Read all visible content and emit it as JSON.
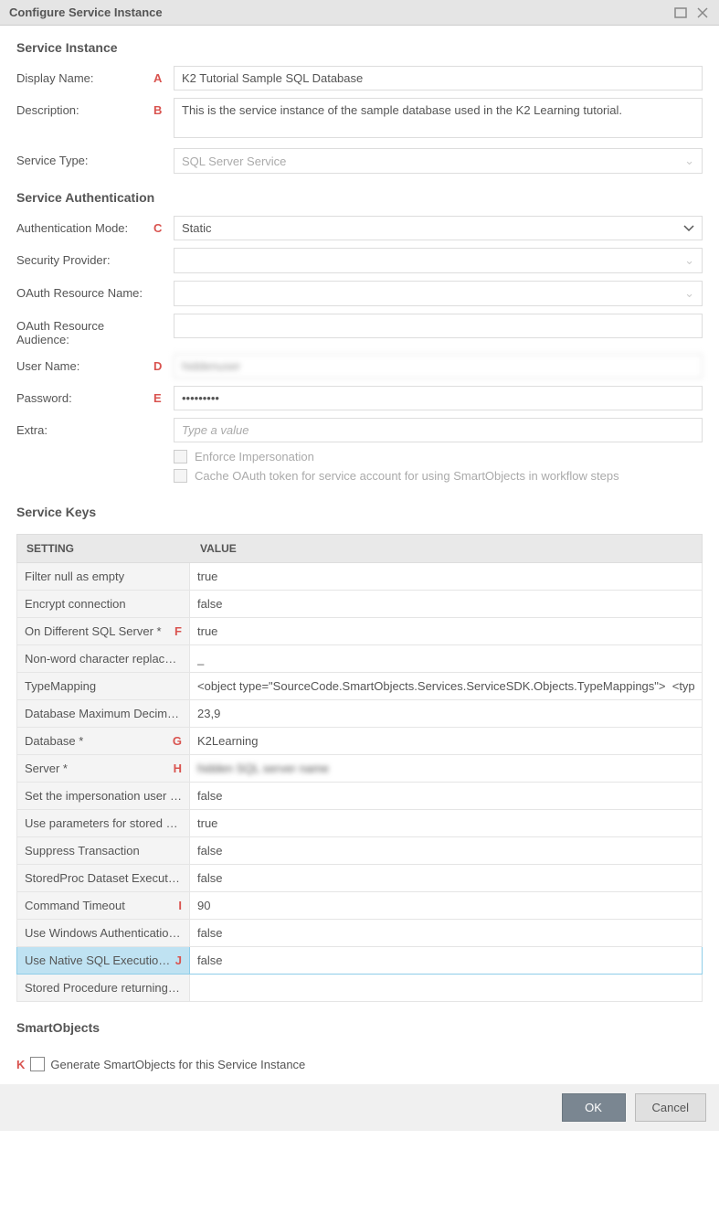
{
  "titlebar": {
    "title": "Configure Service Instance"
  },
  "sections": {
    "instance": "Service Instance",
    "auth": "Service Authentication",
    "keys": "Service Keys",
    "smartobj": "SmartObjects"
  },
  "instance": {
    "displayName_label": "Display Name:",
    "displayName_marker": "A",
    "displayName_value": "K2 Tutorial Sample SQL Database",
    "description_label": "Description:",
    "description_marker": "B",
    "description_value": "This is the service instance of the sample database used in the K2 Learning tutorial.",
    "serviceType_label": "Service Type:",
    "serviceType_value": "SQL Server Service"
  },
  "auth": {
    "mode_label": "Authentication Mode:",
    "mode_marker": "C",
    "mode_value": "Static",
    "securityProvider_label": "Security Provider:",
    "securityProvider_value": "",
    "oauthResource_label": "OAuth Resource Name:",
    "oauthResource_value": "",
    "oauthAudience_label": "OAuth Resource Audience:",
    "oauthAudience_value": "",
    "userName_label": "User Name:",
    "userName_marker": "D",
    "userName_value": "hiddenuser",
    "password_label": "Password:",
    "password_marker": "E",
    "password_value": "•••••••••",
    "extra_label": "Extra:",
    "extra_placeholder": "Type a value",
    "extra_value": "",
    "enforce_label": "Enforce Impersonation",
    "cache_label": "Cache OAuth token for service account for using SmartObjects in workflow steps"
  },
  "keys": {
    "header_setting": "SETTING",
    "header_value": "VALUE",
    "rows": [
      {
        "label": "Filter null as empty",
        "marker": "",
        "value": "true"
      },
      {
        "label": "Encrypt connection",
        "marker": "",
        "value": "false"
      },
      {
        "label": "On Different SQL Server *",
        "marker": "F",
        "value": "true"
      },
      {
        "label": "Non-word character replaceme…",
        "marker": "",
        "value": "_"
      },
      {
        "label": "TypeMapping",
        "marker": "",
        "value": "<object type=\"SourceCode.SmartObjects.Services.ServiceSDK.Objects.TypeMappings\">  <typemappi"
      },
      {
        "label": "Database Maximum Decimal Va…",
        "marker": "",
        "value": "23,9"
      },
      {
        "label": "Database *",
        "marker": "G",
        "value": "K2Learning"
      },
      {
        "label": "Server *",
        "marker": "H",
        "value": "hidden SQL server name",
        "blur": true
      },
      {
        "label": "Set the impersonation user on t…",
        "marker": "",
        "value": "false"
      },
      {
        "label": "Use parameters for stored proc…",
        "marker": "",
        "value": "true"
      },
      {
        "label": "Suppress Transaction",
        "marker": "",
        "value": "false"
      },
      {
        "label": "StoredProc Dataset Execution",
        "marker": "",
        "value": "false"
      },
      {
        "label": "Command Timeout",
        "marker": "I",
        "value": "90"
      },
      {
        "label": "Use Windows Authentication fo…",
        "marker": "",
        "value": "false"
      },
      {
        "label": "Use Native SQL Execution *",
        "marker": "J",
        "value": "false",
        "selected": true
      },
      {
        "label": "Stored Procedure returning XM…",
        "marker": "",
        "value": ""
      }
    ]
  },
  "smartobj": {
    "gen_marker": "K",
    "gen_label": "Generate SmartObjects for this Service Instance"
  },
  "footer": {
    "ok": "OK",
    "cancel": "Cancel"
  }
}
